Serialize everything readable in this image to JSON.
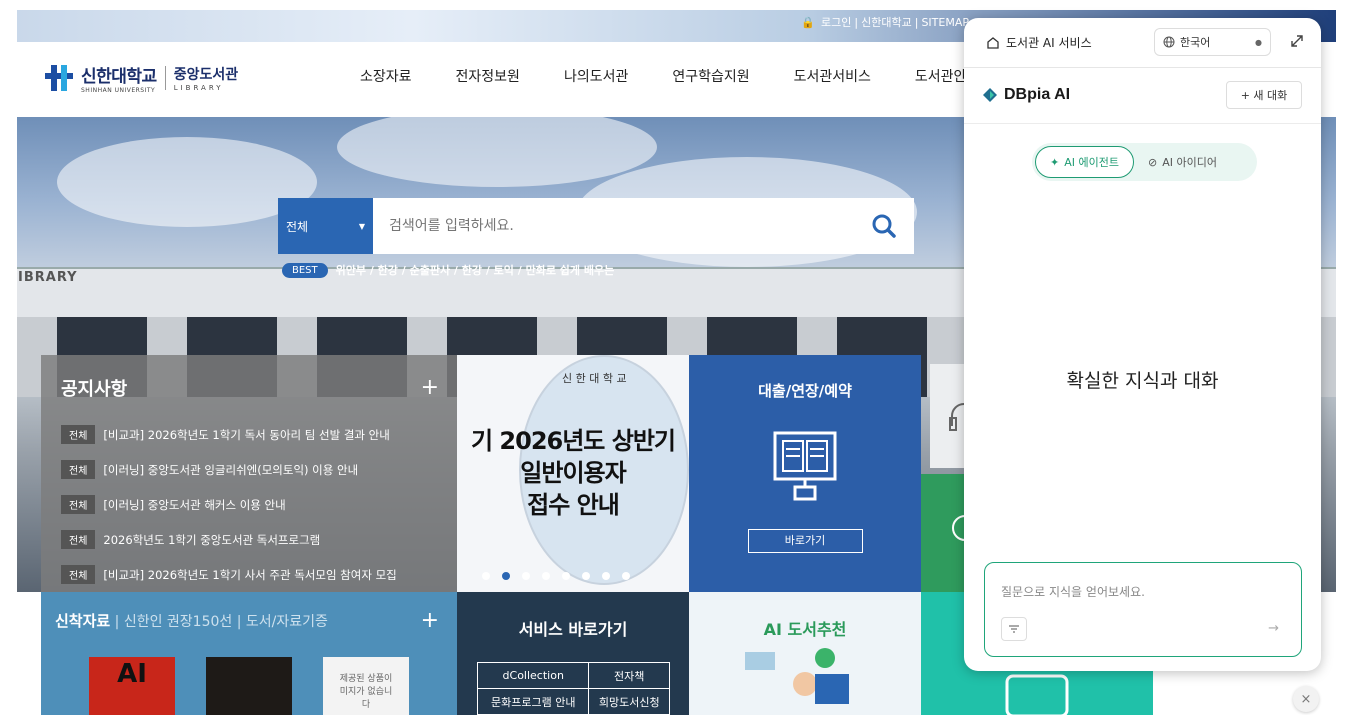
{
  "top_links": {
    "login": "로그인",
    "univ": "신한대학교",
    "sitemap": "SITEMAP"
  },
  "logo": {
    "univ_kr": "신한대학교",
    "univ_en": "SHINHAN UNIVERSITY",
    "lib_kr": "중앙도서관",
    "lib_en": "LIBRARY"
  },
  "gnb": [
    "소장자료",
    "전자정보원",
    "나의도서관",
    "연구학습지원",
    "도서관서비스",
    "도서관안내"
  ],
  "hero": {
    "building_text": "IBRARY"
  },
  "search": {
    "scope": "전체",
    "placeholder": "검색어를 입력하세요.",
    "best_label": "BEST",
    "best_text": "위안부 / 한강 / 순출판사 / 한강 / 토익 / 만화로 쉽게 배우는"
  },
  "notice": {
    "title": "공지사항",
    "plus": "+",
    "items": [
      {
        "cat": "전체",
        "text": "[비교과] 2026학년도 1학기 독서 동아리 팀 선발 결과 안내"
      },
      {
        "cat": "전체",
        "text": "[이러닝] 중앙도서관 잉글리쉬엔(모의토익) 이용 안내"
      },
      {
        "cat": "전체",
        "text": "[이러닝] 중앙도서관 해커스 이용 안내"
      },
      {
        "cat": "전체",
        "text": "2026학년도 1학기 중앙도서관 독서프로그램"
      },
      {
        "cat": "전체",
        "text": "[비교과] 2026학년도 1학기 사서 주관 독서모임 참여자 모집"
      }
    ]
  },
  "banner": {
    "seal_text": "신 한 대 학 교",
    "line1": "기   2026년도 상반기",
    "line2": "일반이용자",
    "line3": "접수 안내",
    "dots": 8,
    "active_dot": 1
  },
  "loan": {
    "title": "대출/연장/예약",
    "button": "바로가기"
  },
  "newbooks": {
    "tab1": "신착자료",
    "tab2": "신한인 권장150선",
    "tab3": "도서/자료기증",
    "plus": "+",
    "book3_text": "제공된 상품이미지가 없습니다"
  },
  "service": {
    "title": "서비스 바로가기",
    "cells": [
      [
        "dCollection",
        "전자책"
      ],
      [
        "문화프로그램 안내",
        "희망도서신청"
      ]
    ]
  },
  "airec": {
    "title": "AI 도서추천"
  },
  "aipanel": {
    "header_title": "도서관 AI 서비스",
    "language": "한국어",
    "brand": "DBpia AI",
    "new_chat": "+ 새 대화",
    "tab_agent": "AI 에이전트",
    "tab_idea": "AI 아이디어",
    "main_text": "확실한 지식과 대화",
    "input_placeholder": "질문으로 지식을 얻어보세요.",
    "send": "→"
  },
  "close": "×",
  "colors": {
    "primary": "#2a66b3",
    "ai_accent": "#1f9b73",
    "navy": "#1b2f6b"
  }
}
